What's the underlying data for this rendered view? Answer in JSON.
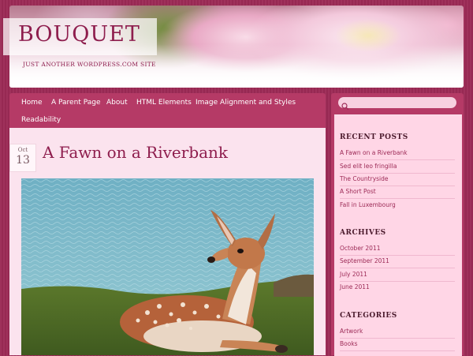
{
  "site": {
    "title": "Bouquet",
    "tagline": "Just another WordPress.com site"
  },
  "nav": {
    "items": [
      {
        "label": "Home"
      },
      {
        "label": "A Parent Page"
      },
      {
        "label": "About"
      },
      {
        "label": "HTML Elements"
      },
      {
        "label": "Image Alignment and Styles"
      },
      {
        "label": "Readability"
      }
    ]
  },
  "post": {
    "date_month": "Oct",
    "date_day": "13",
    "title": "A Fawn on a Riverbank",
    "image_subject": "fawn resting on grass by water"
  },
  "sidebar": {
    "search": {
      "value": "",
      "placeholder": ""
    },
    "recent_posts": {
      "title": "Recent Posts",
      "items": [
        "A Fawn on a Riverbank",
        "Sed elit leo fringilla",
        "The Countryside",
        "A Short Post",
        "Fall in Luxembourg"
      ]
    },
    "archives": {
      "title": "Archives",
      "items": [
        "October 2011",
        "September 2011",
        "July 2011",
        "June 2011"
      ]
    },
    "categories": {
      "title": "Categories",
      "items": [
        "Artwork",
        "Books"
      ]
    }
  },
  "colors": {
    "background": "#9c2a56",
    "accent": "#b53a66",
    "title": "#8e1d4d",
    "content_bg": "#fbe3ee",
    "sidebar_bg": "#ffd6e6"
  }
}
